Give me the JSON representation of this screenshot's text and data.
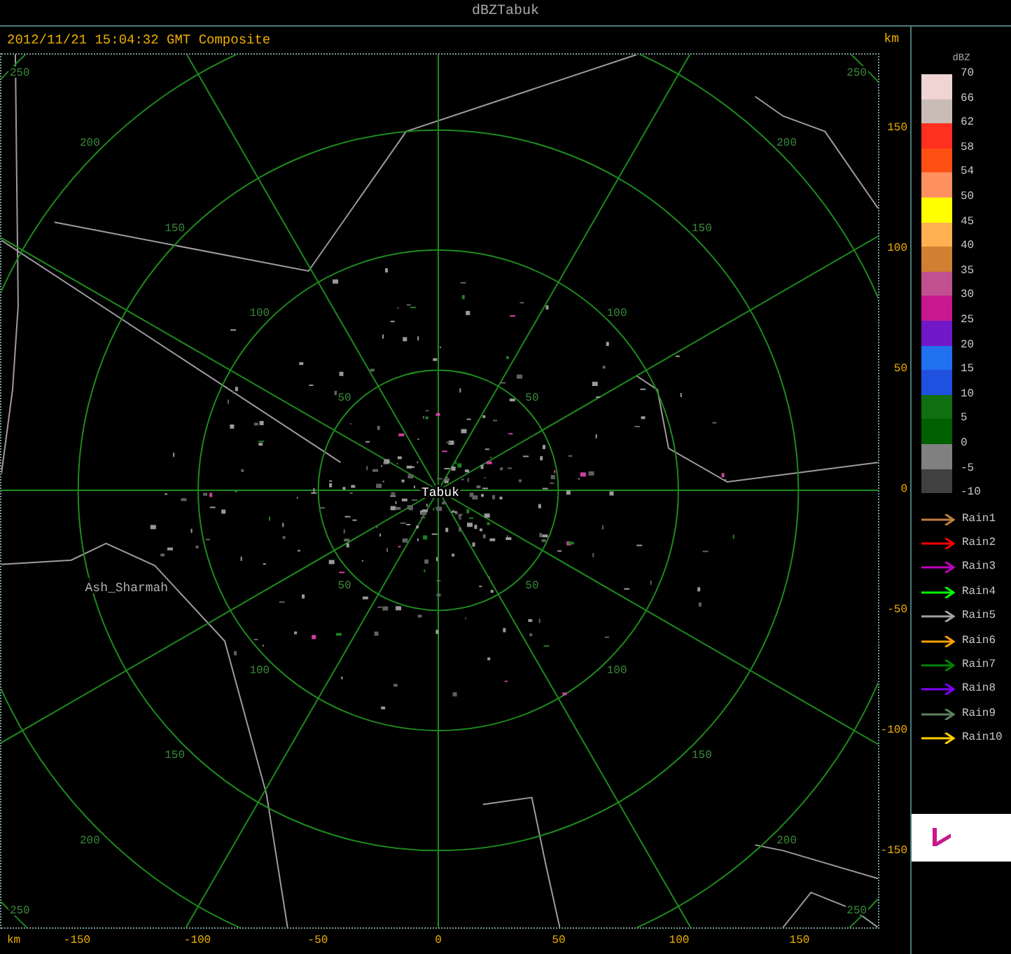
{
  "window": {
    "title": "dBZTabuk"
  },
  "plot": {
    "header": "2012/11/21 15:04:32 GMT Composite",
    "unit_top": "km",
    "unit_bottom": "km",
    "range_rings": [
      {
        "labels": [
          "50",
          "50",
          "50",
          "50"
        ]
      },
      {
        "labels": [
          "100",
          "100",
          "100",
          "100"
        ]
      },
      {
        "labels": [
          "150",
          "150",
          "150",
          "150"
        ]
      },
      {
        "labels": [
          "200",
          "200",
          "200",
          "200"
        ]
      },
      {
        "labels": [
          "250",
          "250",
          "250",
          "250"
        ]
      }
    ],
    "places": [
      {
        "name": "Tabuk",
        "kind": "radar"
      },
      {
        "name": "Ash_Sharmah",
        "kind": "town"
      }
    ],
    "y_ticks": [
      "150",
      "100",
      "50",
      "0",
      "-50",
      "-100",
      "-150"
    ],
    "x_ticks": [
      "-150",
      "-100",
      "-50",
      "0",
      "50",
      "100",
      "150"
    ]
  },
  "legend": {
    "title": "dBZ",
    "labels": [
      "70",
      "66",
      "62",
      "58",
      "54",
      "50",
      "45",
      "40",
      "35",
      "30",
      "25",
      "20",
      "15",
      "10",
      "5",
      "0",
      "-5",
      "-10"
    ],
    "bins": [
      {
        "color": "#f0d4d4"
      },
      {
        "color": "#c8bcb4"
      },
      {
        "color": "#ff3020"
      },
      {
        "color": "#ff5014"
      },
      {
        "color": "#ff9060"
      },
      {
        "color": "#ffff00"
      },
      {
        "color": "#ffb050"
      },
      {
        "color": "#d08030"
      },
      {
        "color": "#c05090"
      },
      {
        "color": "#c81890"
      },
      {
        "color": "#7018c8"
      },
      {
        "color": "#2070f0"
      },
      {
        "color": "#2050e0"
      },
      {
        "color": "#107010"
      },
      {
        "color": "#006000"
      },
      {
        "color": "#808080"
      },
      {
        "color": "#404040"
      }
    ],
    "tracks": [
      {
        "label": "Rain1",
        "color": "#c08040"
      },
      {
        "label": "Rain2",
        "color": "#ff0000"
      },
      {
        "label": "Rain3",
        "color": "#c000c0"
      },
      {
        "label": "Rain4",
        "color": "#00ff00"
      },
      {
        "label": "Rain5",
        "color": "#a0a0a0"
      },
      {
        "label": "Rain6",
        "color": "#ffa000"
      },
      {
        "label": "Rain7",
        "color": "#008000"
      },
      {
        "label": "Rain8",
        "color": "#8000ff"
      },
      {
        "label": "Rain9",
        "color": "#608060"
      },
      {
        "label": "Rain10",
        "color": "#ffd000"
      }
    ]
  }
}
